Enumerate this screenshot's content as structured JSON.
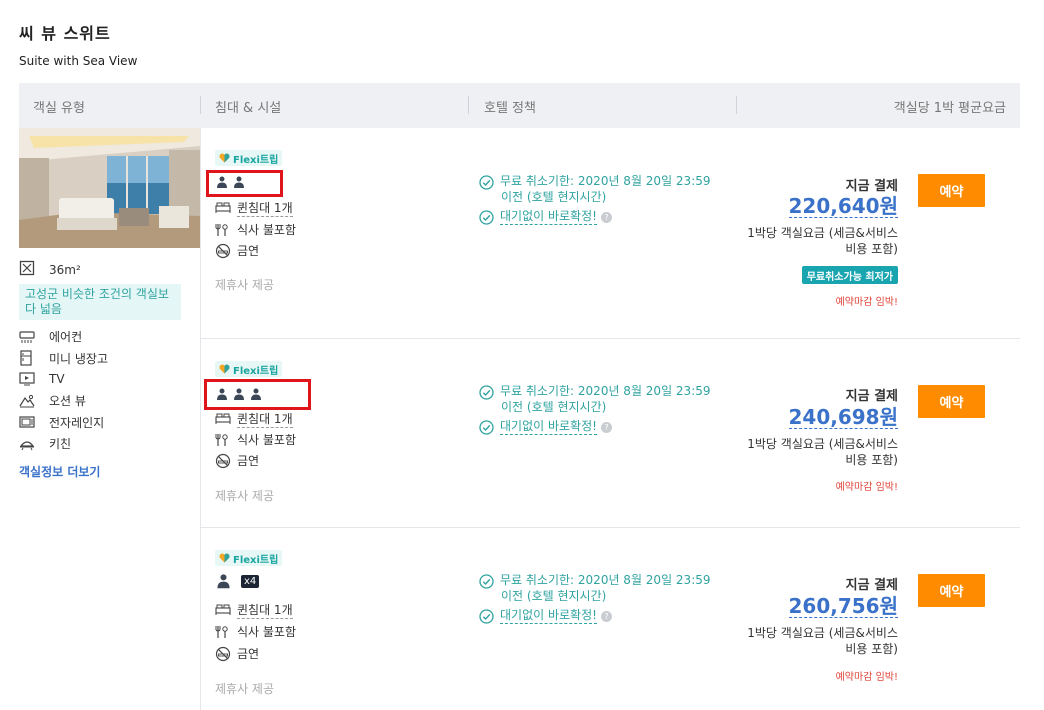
{
  "room": {
    "title": "씨 뷰 스위트",
    "subtitle": "Suite with Sea View"
  },
  "table_header": {
    "room_type": "객실 유형",
    "bed_facilities": "침대 & 시설",
    "hotel_policy": "호텔 정책",
    "avg_rate": "객실당 1박 평균요금"
  },
  "room_info": {
    "size": "36m²",
    "note": "고성군 비슷한 조건의 객실보다 넓음",
    "amenities": [
      {
        "icon": "air-conditioner-icon",
        "label": "에어컨"
      },
      {
        "icon": "mini-fridge-icon",
        "label": "미니 냉장고"
      },
      {
        "icon": "tv-icon",
        "label": "TV"
      },
      {
        "icon": "ocean-view-icon",
        "label": "오션 뷰"
      },
      {
        "icon": "microwave-icon",
        "label": "전자레인지"
      },
      {
        "icon": "kitchen-icon",
        "label": "키친"
      }
    ],
    "more_link": "객실정보 더보기"
  },
  "offers": [
    {
      "flexi": "Flexi트립",
      "guests": 2,
      "bed": "퀸침대 1개",
      "meal": "식사 불포함",
      "smoking": "금연",
      "partner": "제휴사 제공",
      "cancel_line1": "무료 취소기한: 2020년 8월 20일 23:59",
      "cancel_line2": "이전 (호텔 현지시간)",
      "instant": "대기없이 바로확정!",
      "pay_label": "지금 결제",
      "price": "220,640원",
      "price_note": "1박당 객실요금 (세금&서비스비용 포함)",
      "badge": "무료취소가능 최저가",
      "urgent": "예약마감 임박!",
      "book": "예약"
    },
    {
      "flexi": "Flexi트립",
      "guests": 3,
      "bed": "퀸침대 1개",
      "meal": "식사 불포함",
      "smoking": "금연",
      "partner": "제휴사 제공",
      "cancel_line1": "무료 취소기한: 2020년 8월 20일 23:59",
      "cancel_line2": "이전 (호텔 현지시간)",
      "instant": "대기없이 바로확정!",
      "pay_label": "지금 결제",
      "price": "240,698원",
      "price_note": "1박당 객실요금 (세금&서비스비용 포함)",
      "urgent": "예약마감 임박!",
      "book": "예약"
    },
    {
      "flexi": "Flexi트립",
      "guests_label": "x4",
      "bed": "퀸침대 1개",
      "meal": "식사 불포함",
      "smoking": "금연",
      "partner": "제휴사 제공",
      "cancel_line1": "무료 취소기한: 2020년 8월 20일 23:59",
      "cancel_line2": "이전 (호텔 현지시간)",
      "instant": "대기없이 바로확정!",
      "pay_label": "지금 결제",
      "price": "260,756원",
      "price_note": "1박당 객실요금 (세금&서비스비용 포함)",
      "urgent": "예약마감 임박!",
      "book": "예약"
    }
  ],
  "colors": {
    "accent_blue": "#3a72c9",
    "teal": "#2fa3a0",
    "book_orange": "#ff8c00",
    "highlight_red": "#e0151c",
    "urgent_red": "#e0453a"
  }
}
